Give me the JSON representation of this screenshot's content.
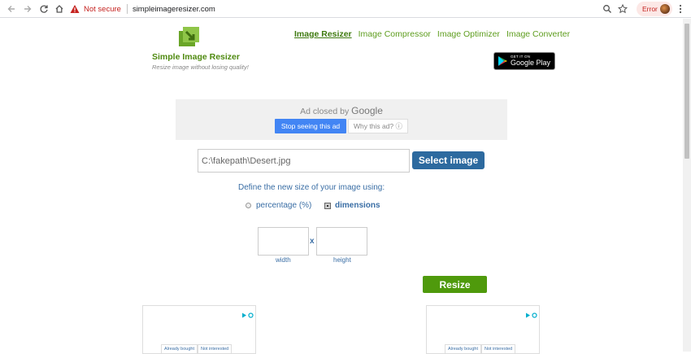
{
  "browser": {
    "security_label": "Not secure",
    "url": "simpleimageresizer.com",
    "error_chip": "Error"
  },
  "brand": {
    "title": "Simple Image Resizer",
    "tagline": "Resize image without losing quality!"
  },
  "nav": [
    {
      "label": "Image Resizer",
      "active": true
    },
    {
      "label": "Image Compressor",
      "active": false
    },
    {
      "label": "Image Optimizer",
      "active": false
    },
    {
      "label": "Image Converter",
      "active": false
    }
  ],
  "store_badge": {
    "small": "GET IT ON",
    "big": "Google Play"
  },
  "ad": {
    "closed_text": "Ad closed by",
    "provider": "Google",
    "stop_label": "Stop seeing this ad",
    "why_label": "Why this ad? ⓘ"
  },
  "upload": {
    "file_value": "C:\\fakepath\\Desert.jpg",
    "select_label": "Select image"
  },
  "resize_options": {
    "prompt": "Define the new size of your image using:",
    "percentage_label": "percentage (%)",
    "dimensions_label": "dimensions",
    "selected": "dimensions",
    "separator": "x",
    "width_label": "width",
    "height_label": "height",
    "width_value": "",
    "height_value": ""
  },
  "resize_button": "Resize",
  "ad_tiles": [
    {
      "already_bought": "Already bought",
      "not_interested": "Not interested"
    },
    {
      "already_bought": "Already bought",
      "not_interested": "Not interested"
    }
  ],
  "colors": {
    "brand_green": "#4f8a10",
    "nav_green": "#5e9d1e",
    "select_blue": "#2d6a9f",
    "resize_green": "#4f9a0c",
    "ad_blue": "#4285f4"
  }
}
